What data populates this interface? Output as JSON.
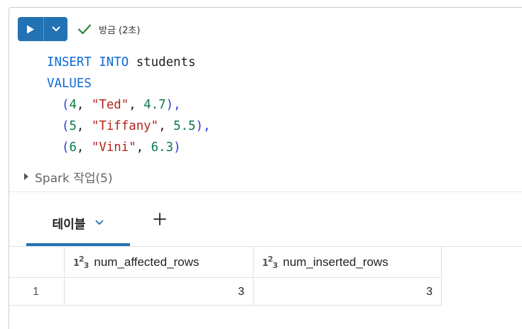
{
  "toolbar": {
    "run_icon": "play-icon",
    "menu_icon": "chevron-down-icon",
    "status_icon": "check-icon",
    "status_text": "방금 (2초)"
  },
  "code": {
    "line1_kw1": "INSERT",
    "line1_kw2": "INTO",
    "line1_table": "students",
    "line2_kw": "VALUES",
    "rows": [
      {
        "id": "4",
        "name": "\"Ted\"",
        "score": "4.7",
        "end": "),"
      },
      {
        "id": "5",
        "name": "\"Tiffany\"",
        "score": "5.5",
        "end": "),"
      },
      {
        "id": "6",
        "name": "\"Vini\"",
        "score": "6.3",
        "end": ")"
      }
    ]
  },
  "spark": {
    "label": "Spark 작업(5)"
  },
  "tabs": {
    "active_label": "테이블",
    "add_icon": "plus-icon"
  },
  "table": {
    "columns": [
      {
        "name": "num_affected_rows",
        "type_icon": "integer-type-icon"
      },
      {
        "name": "num_inserted_rows",
        "type_icon": "integer-type-icon"
      }
    ],
    "rows": [
      {
        "index": "1",
        "values": [
          "3",
          "3"
        ]
      }
    ]
  },
  "colors": {
    "accent": "#2272b4",
    "success": "#2e8540",
    "keyword": "#0e6ad4",
    "string": "#b3261e",
    "number": "#0b7a4a"
  }
}
